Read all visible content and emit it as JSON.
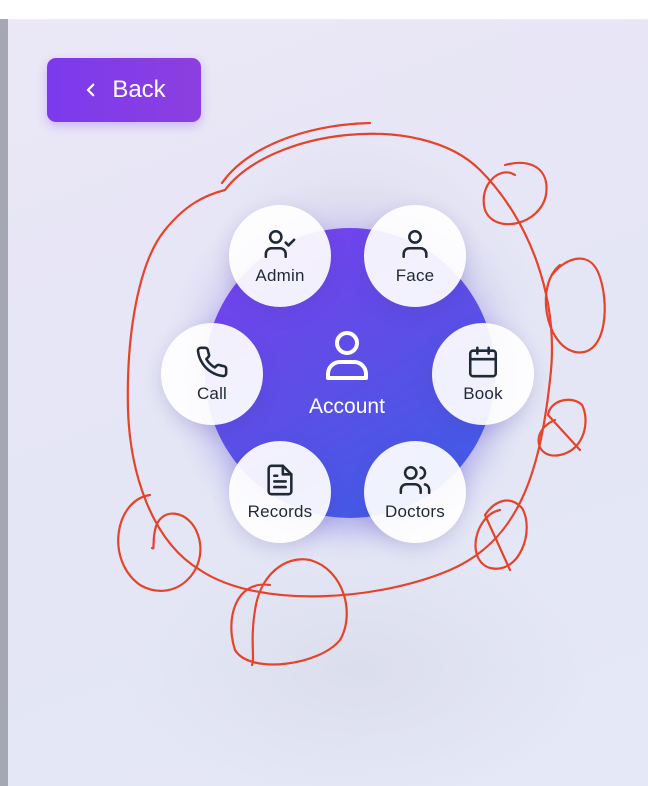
{
  "back_button": {
    "label": "Back",
    "icon": "chevron-left-icon"
  },
  "hub": {
    "label": "Account",
    "icon": "user-icon"
  },
  "menu": [
    {
      "key": "admin",
      "label": "Admin",
      "icon": "user-check-icon"
    },
    {
      "key": "face",
      "label": "Face",
      "icon": "user-icon"
    },
    {
      "key": "call",
      "label": "Call",
      "icon": "phone-icon"
    },
    {
      "key": "book",
      "label": "Book",
      "icon": "calendar-icon"
    },
    {
      "key": "records",
      "label": "Records",
      "icon": "file-text-icon"
    },
    {
      "key": "doctors",
      "label": "Doctors",
      "icon": "users-icon"
    }
  ],
  "colors": {
    "accent": "#7c3aed",
    "hub_start": "#7b3ff0",
    "hub_end": "#3a5fe6",
    "icon": "#1f2937",
    "annotation": "#e5432a"
  }
}
